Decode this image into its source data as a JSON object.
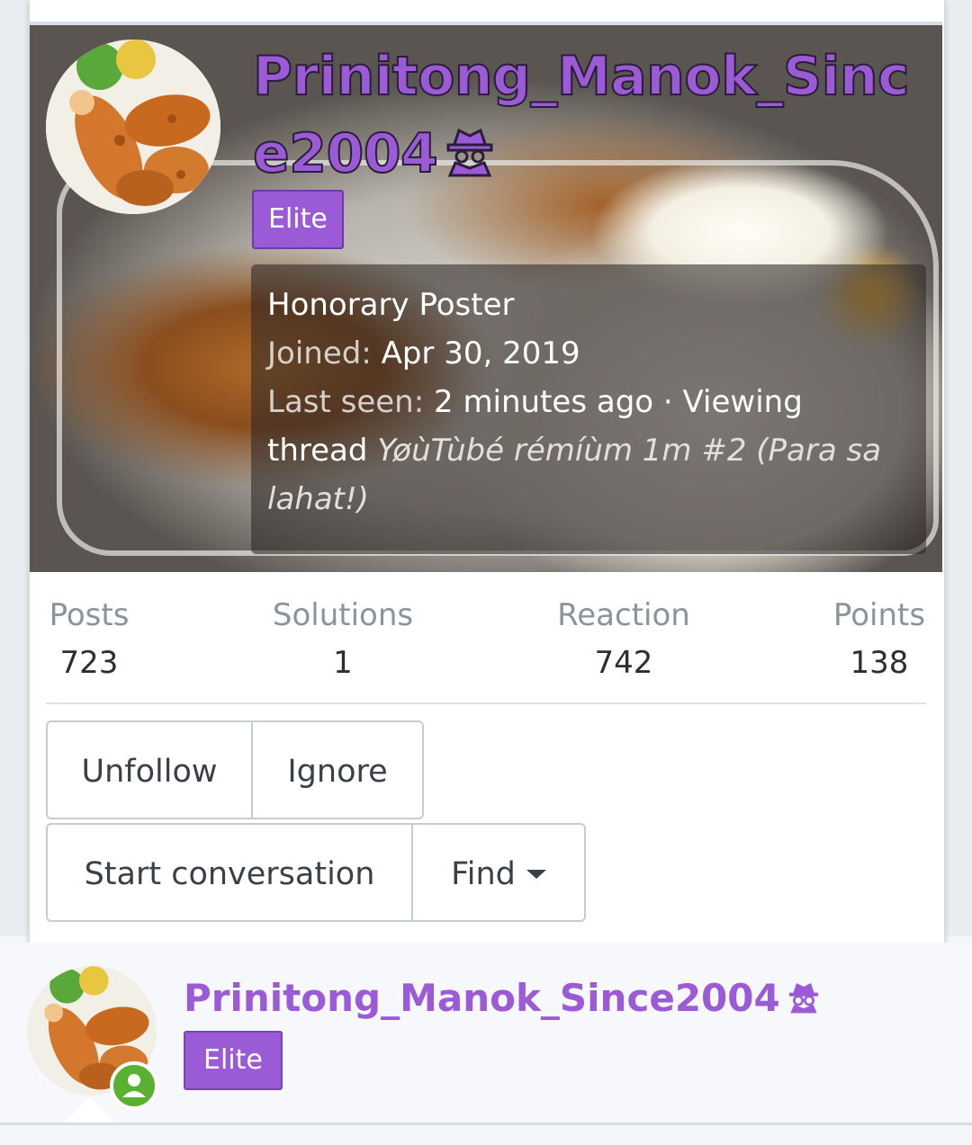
{
  "tooltip": {
    "username": "Prinitong_Manok_Since2004",
    "badge": "Elite",
    "user_title": "Honorary Poster",
    "joined_label": "Joined:",
    "joined_value": "Apr 30, 2019",
    "last_seen_label": "Last seen:",
    "last_seen_value": "2 minutes ago · Viewing thread",
    "viewing_thread_title": "YøùTùbé rémíùm 1m #2 (Para sa lahat!)",
    "stats": [
      {
        "label": "Posts",
        "value": "723"
      },
      {
        "label": "Solutions",
        "value": "1"
      },
      {
        "label": "Reaction",
        "value": "742"
      },
      {
        "label": "Points",
        "value": "138"
      }
    ],
    "buttons": {
      "unfollow": "Unfollow",
      "ignore": "Ignore",
      "start_conversation": "Start conversation",
      "find": "Find"
    }
  },
  "post_author": {
    "username": "Prinitong_Manok_Since2004",
    "badge": "Elite",
    "status": "online"
  },
  "colors": {
    "username_purple": "#9b5ad6",
    "badge_purple": "#9b5ad6",
    "online_green": "#5ab030",
    "border_gray": "#c7ccd2"
  },
  "icons": [
    "spy-icon",
    "caret-down-icon",
    "online-user-icon",
    "fried-chicken-avatar"
  ]
}
